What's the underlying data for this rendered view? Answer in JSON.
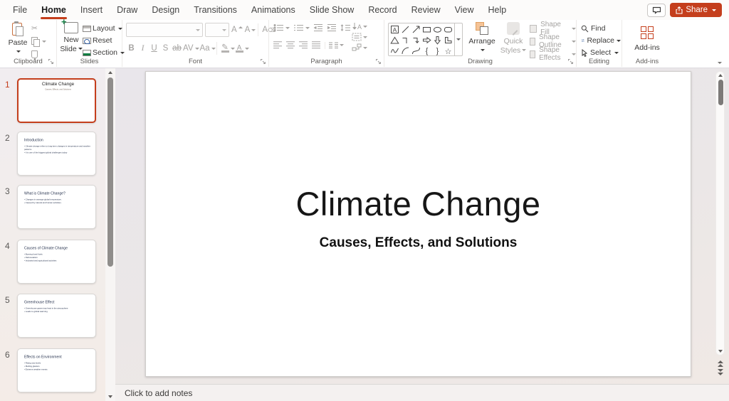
{
  "titlebar": {
    "share_label": "Share"
  },
  "menu": {
    "active_tab": "Home",
    "tabs": [
      "File",
      "Home",
      "Insert",
      "Draw",
      "Design",
      "Transitions",
      "Animations",
      "Slide Show",
      "Record",
      "Review",
      "View",
      "Help"
    ]
  },
  "ribbon": {
    "clipboard": {
      "label": "Clipboard",
      "paste": "Paste"
    },
    "slides": {
      "label": "Slides",
      "new_slide": "New Slide",
      "layout": "Layout",
      "reset": "Reset",
      "section": "Section"
    },
    "font": {
      "label": "Font",
      "bold": "B",
      "italic": "I",
      "underline": "U",
      "shadow": "S",
      "strikethrough": "ab",
      "spacing": "AV",
      "case": "Aa",
      "size_up": "A",
      "size_down": "A",
      "clear": "A"
    },
    "paragraph": {
      "label": "Paragraph"
    },
    "drawing": {
      "label": "Drawing",
      "arrange": "Arrange",
      "quick_styles": "Quick Styles",
      "shape_fill": "Shape Fill",
      "shape_outline": "Shape Outline",
      "shape_effects": "Shape Effects",
      "shapes": [
        "text-box",
        "line",
        "arrow",
        "rectangle",
        "oval",
        "rounded-rectangle",
        "triangle",
        "elbow-connector",
        "elbow-arrow-connector",
        "arrow-right",
        "arrow-down",
        "l-shape",
        "freeform",
        "arc",
        "curve",
        "left-brace",
        "right-brace",
        "star"
      ]
    },
    "editing": {
      "label": "Editing",
      "find": "Find",
      "replace": "Replace",
      "select": "Select"
    },
    "addins": {
      "label": "Add-ins",
      "button": "Add-ins"
    }
  },
  "thumbnails": [
    {
      "num": "1",
      "selected": true,
      "title": "Climate Change",
      "subtitle": "Causes, Effects, and Solutions",
      "bullets": []
    },
    {
      "num": "2",
      "selected": false,
      "title": "Introduction",
      "bullets": [
        "Climate change refers to long-term changes in temperature and weather patterns",
        "It is one of the biggest global challenges today"
      ]
    },
    {
      "num": "3",
      "selected": false,
      "title": "What is Climate Change?",
      "bullets": [
        "Changes in average global temperature.",
        "Caused by natural and human activities."
      ]
    },
    {
      "num": "4",
      "selected": false,
      "title": "Causes of Climate Change",
      "bullets": [
        "Burning fossil fuels",
        "Deforestation",
        "Industrial and agricultural activities"
      ]
    },
    {
      "num": "5",
      "selected": false,
      "title": "Greenhouse Effect",
      "bullets": [
        "Greenhouse gases trap heat in the atmosphere",
        "Leads to global warming"
      ]
    },
    {
      "num": "6",
      "selected": false,
      "title": "Effects on Environment",
      "bullets": [
        "Rising sea levels",
        "Melting glaciers",
        "Extreme weather events"
      ]
    }
  ],
  "slide": {
    "title": "Climate Change",
    "subtitle": "Causes, Effects, and Solutions"
  },
  "notes": {
    "placeholder": "Click to add notes"
  },
  "colors": {
    "accent": "#C43E1C",
    "disabled": "#A6A4A2",
    "ink": "#3B3A39"
  }
}
